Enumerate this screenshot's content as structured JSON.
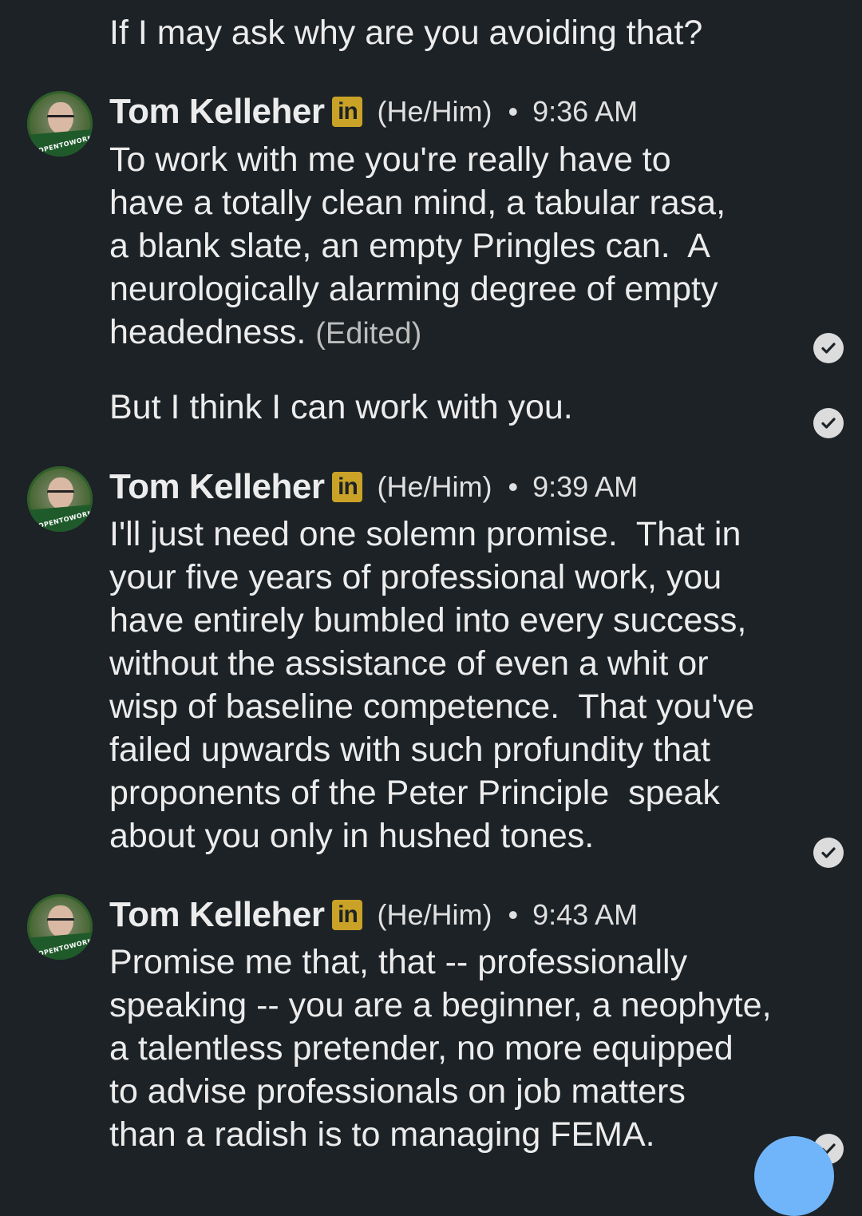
{
  "messages": [
    {
      "type": "continuation",
      "text": "If I may ask why are you avoiding that?"
    },
    {
      "type": "group",
      "sender": "Tom Kelleher",
      "badge": "in",
      "pronouns": "(He/Him)",
      "separator": "•",
      "time": "9:36 AM",
      "avatar_badge": "#OPENTOWORK",
      "bodies": [
        {
          "text": "To work with me you're really have to\nhave a totally clean mind, a tabular rasa,\na blank slate, an empty Pringles can.  A\nneurologically alarming degree of empty\nheadedness. ",
          "edited": "(Edited)",
          "read_receipt": "check-icon"
        },
        {
          "text": "But I think I can work with you.",
          "read_receipt": "check-icon"
        }
      ]
    },
    {
      "type": "group",
      "sender": "Tom Kelleher",
      "badge": "in",
      "pronouns": "(He/Him)",
      "separator": "•",
      "time": "9:39 AM",
      "avatar_badge": "#OPENTOWORK",
      "bodies": [
        {
          "text": "I'll just need one solemn promise.  That in\nyour five years of professional work, you\nhave entirely bumbled into every success,\nwithout the assistance of even a whit or\nwisp of baseline competence.  That you've\nfailed upwards with such profundity that\nproponents of the Peter Principle  speak\nabout you only in hushed tones.",
          "read_receipt": "check-icon"
        }
      ]
    },
    {
      "type": "group",
      "sender": "Tom Kelleher",
      "badge": "in",
      "pronouns": "(He/Him)",
      "separator": "•",
      "time": "9:43 AM",
      "avatar_badge": "#OPENTOWORK",
      "bodies": [
        {
          "text": "Promise me that, that -- professionally\nspeaking -- you are a beginner, a neophyte,\na talentless pretender, no more equipped\nto advise professionals on job matters\nthan a radish is to managing FEMA.",
          "read_receipt": "check-icon"
        }
      ]
    }
  ],
  "colors": {
    "background": "#1d2226",
    "text": "#ececec",
    "linkedin_badge": "#c9a227",
    "fab": "#70b5f9"
  }
}
